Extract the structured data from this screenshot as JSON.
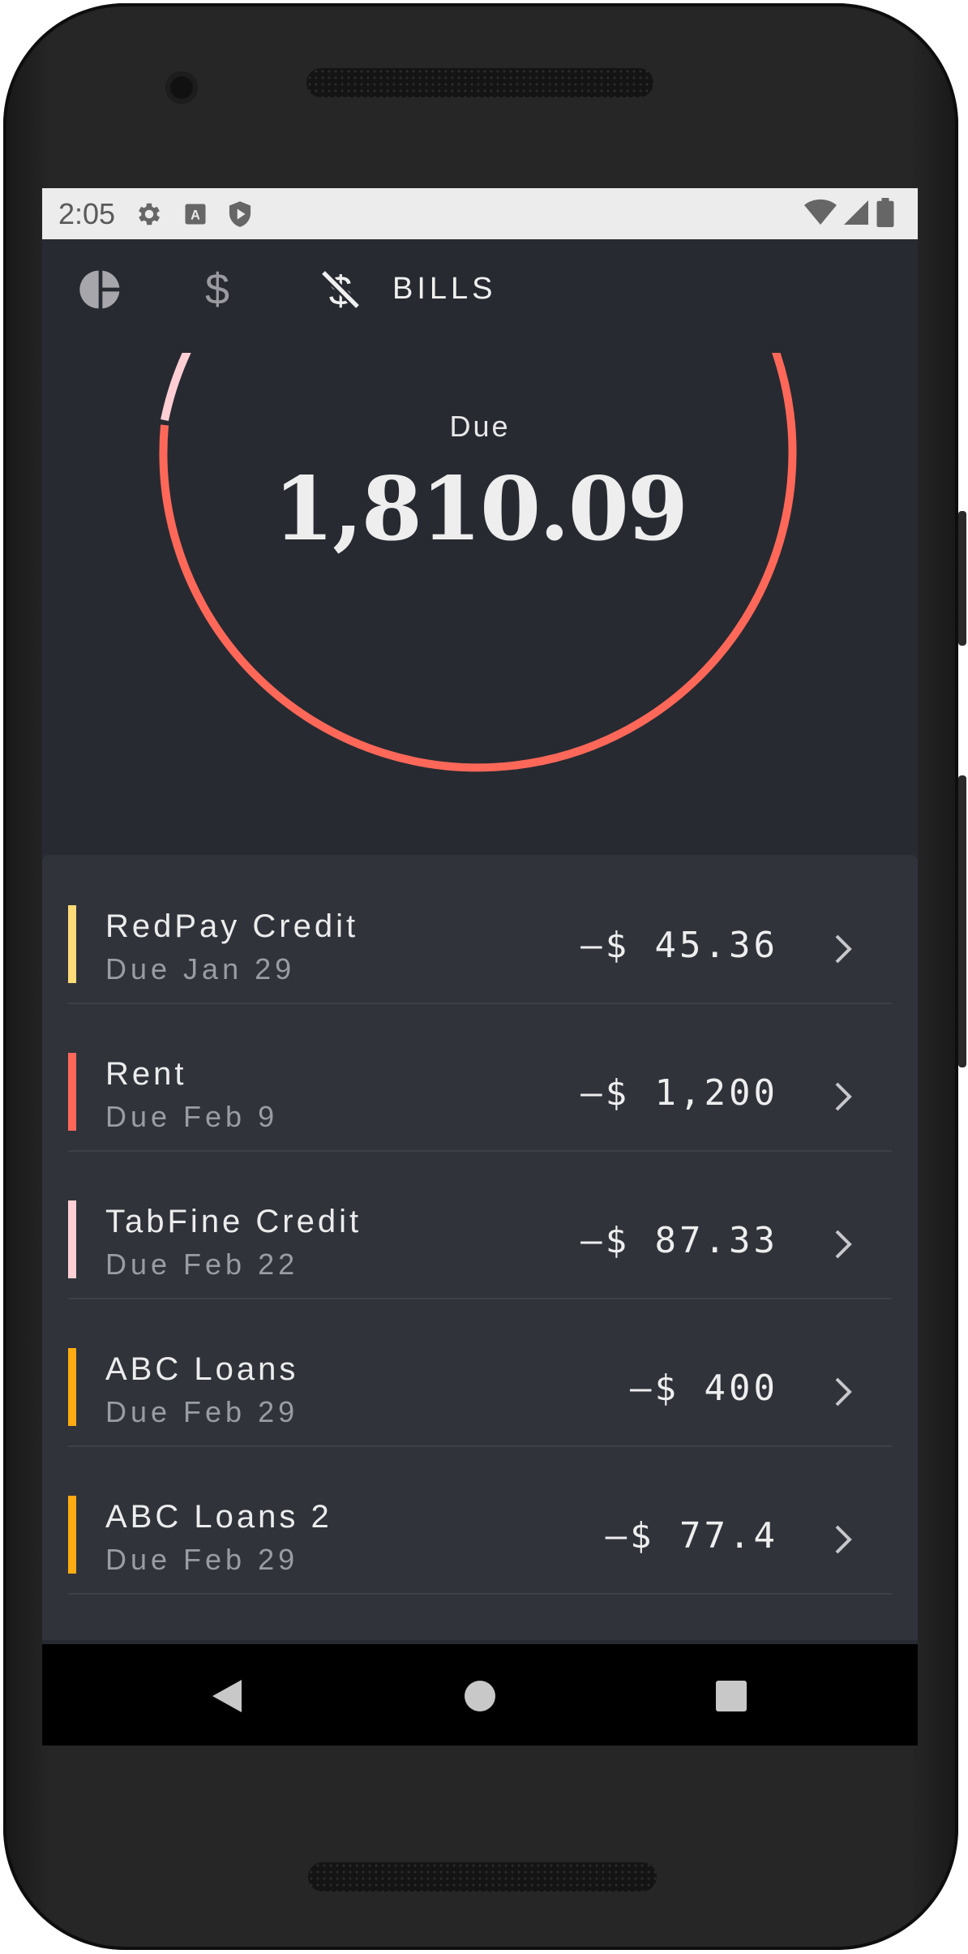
{
  "status_bar": {
    "time": "2:05",
    "left_icons": [
      "gear-icon",
      "keyboard-a-icon",
      "shield-play-icon"
    ],
    "right_icons": [
      "wifi-icon",
      "signal-icon",
      "battery-icon"
    ]
  },
  "tabs": {
    "items": [
      {
        "icon": "pie-chart-icon"
      },
      {
        "icon": "dollar-icon"
      },
      {
        "icon": "no-dollar-icon",
        "label": "BILLS",
        "active": true
      }
    ]
  },
  "summary": {
    "label": "Due",
    "amount": "1,810.09"
  },
  "bills": [
    {
      "name": "RedPay Credit",
      "due": "Due Jan 29",
      "amount": "–$ 45.36",
      "color": "#ffdc78"
    },
    {
      "name": "Rent",
      "due": "Due Feb 9",
      "amount": "–$ 1,200",
      "color": "#ff6859"
    },
    {
      "name": "TabFine Credit",
      "due": "Due Feb 22",
      "amount": "–$ 87.33",
      "color": "#ffcfd5"
    },
    {
      "name": "ABC Loans",
      "due": "Due Feb 29",
      "amount": "–$ 400",
      "color": "#ffac12"
    },
    {
      "name": "ABC Loans 2",
      "due": "Due Feb 29",
      "amount": "–$ 77.4",
      "color": "#ffac12"
    }
  ],
  "colors": {
    "background": "#282a31",
    "list_background": "#31333b",
    "ring": "#ff6859",
    "ring_secondary": "#ffcfd5"
  },
  "nav": [
    "back-icon",
    "home-icon",
    "recents-icon"
  ]
}
